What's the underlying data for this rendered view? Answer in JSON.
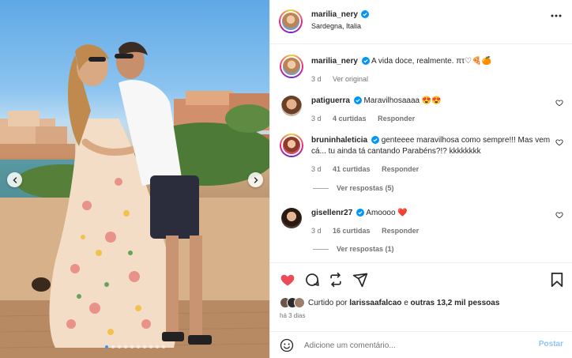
{
  "post": {
    "author": "marilia_nery",
    "location": "Sardegna, Italia",
    "carousel": {
      "slide_count": 10,
      "active_slide": 1
    }
  },
  "caption": {
    "username": "marilia_nery",
    "text": "A vida doce, realmente. πτ♡🍕🍊",
    "age": "3 d",
    "see_translation": "Ver original"
  },
  "comments": [
    {
      "username": "patiguerra",
      "verified": true,
      "text": "Maravilhosaaaa 😍😍",
      "age": "3 d",
      "likes": "4 curtidas",
      "reply": "Responder",
      "view_replies": ""
    },
    {
      "username": "bruninhaleticia",
      "verified": true,
      "text": "genteeee maravilhosa como sempre!!! Mas vem cá... tu ainda tá cantando Parabéns?!? kkkkkkkk",
      "age": "3 d",
      "likes": "41 curtidas",
      "reply": "Responder",
      "view_replies": "Ver respostas (5)"
    },
    {
      "username": "gisellenr27",
      "verified": true,
      "text": "Amoooo ❤️",
      "age": "3 d",
      "likes": "16 curtidas",
      "reply": "Responder",
      "view_replies": "Ver respostas (1)"
    }
  ],
  "engagement": {
    "liked_prefix": "Curtido por",
    "liked_by": "larissaafalcao",
    "liked_joiner": "e",
    "others": "outras 13,2 mil pessoas",
    "posted": "há 3 dias",
    "liked": true
  },
  "comment_box": {
    "placeholder": "Adicione um comentário...",
    "post_label": "Postar"
  },
  "colors": {
    "like_red": "#ed4956",
    "verified_blue": "#0095f6",
    "post_button_disabled": "#8ec5f8",
    "muted_text": "#737373"
  },
  "icons": [
    "more-options-icon",
    "verified-icon",
    "heart-icon",
    "comment-icon",
    "share-icon",
    "send-icon",
    "save-icon",
    "emoji-icon",
    "chevron-left-icon",
    "chevron-right-icon"
  ]
}
